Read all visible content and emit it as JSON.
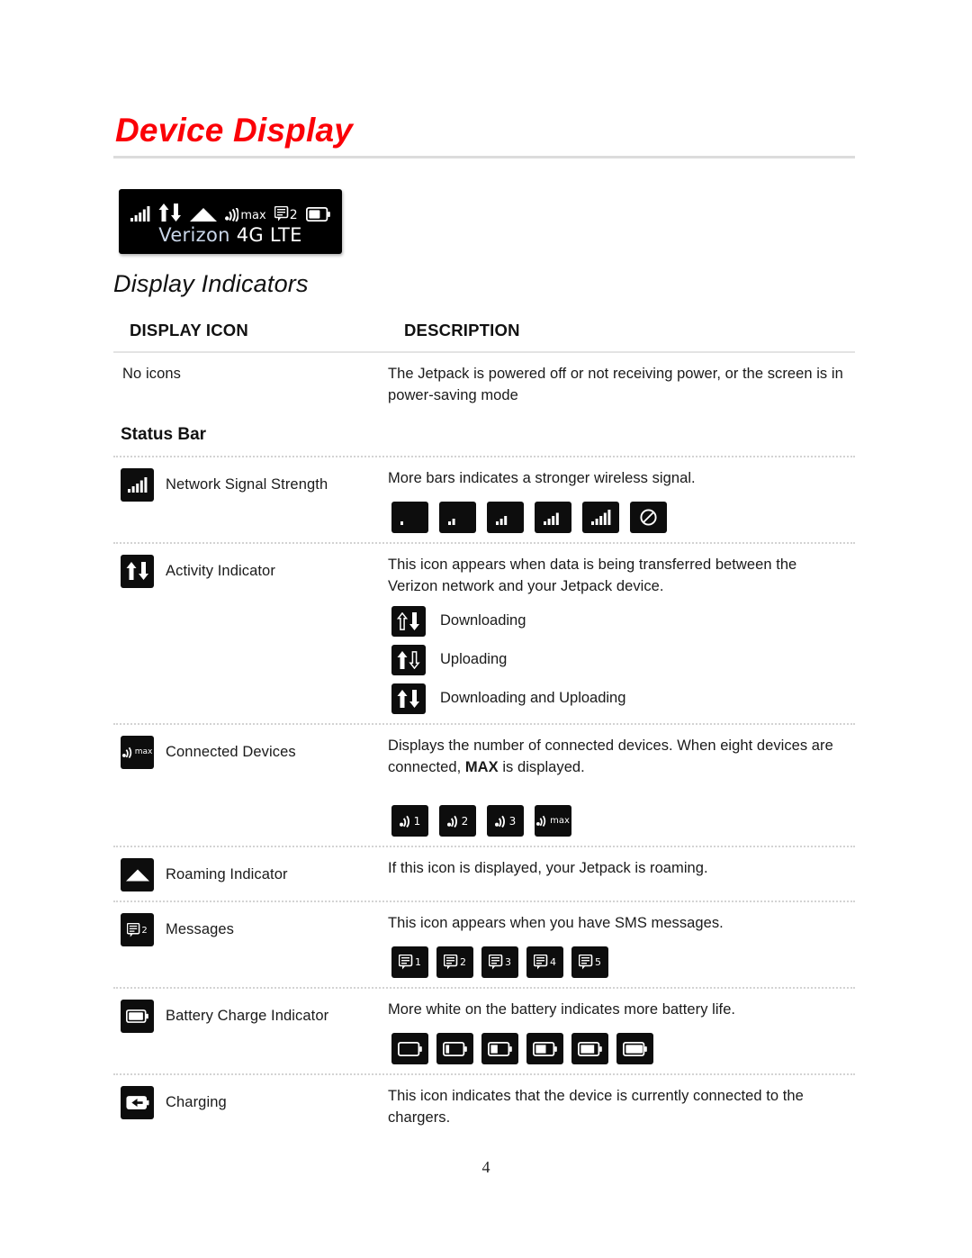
{
  "document": {
    "title": "Device Display",
    "subtitle": "Display Indicators",
    "page_number": "4"
  },
  "device_panel": {
    "name": "jetpack-status-screen",
    "carrier_text_primary": "Verizon ",
    "carrier_text_secondary": "4G LTE",
    "icons": [
      "signal-bars-icon",
      "activity-updown-icon",
      "roaming-triangle-icon",
      "connected-devices-max-icon",
      "messages-2-icon",
      "battery-icon"
    ],
    "connected_label": "max",
    "messages_count": "2"
  },
  "table": {
    "headers": {
      "icon_column": "DISPLAY ICON",
      "description_column": "DESCRIPTION"
    },
    "group_heading": "Status Bar",
    "rows": [
      {
        "id": "no-icons",
        "label": "No icons",
        "description": "The Jetpack is powered off or not receiving power, or the screen is in power-saving mode",
        "has_icon": false,
        "variants": []
      },
      {
        "id": "network-signal-strength",
        "label": "Network Signal Strength",
        "description": "More bars indicates a stronger wireless signal.",
        "has_icon": true,
        "icon": "signal-bars-icon",
        "variants": [
          {
            "name": "signal-0-bars-icon",
            "bars": 0
          },
          {
            "name": "signal-2-bars-icon",
            "bars": 2
          },
          {
            "name": "signal-3-bars-icon",
            "bars": 3
          },
          {
            "name": "signal-4-bars-icon",
            "bars": 4
          },
          {
            "name": "signal-5-bars-icon",
            "bars": 5
          },
          {
            "name": "signal-none-icon",
            "bars": -1
          }
        ]
      },
      {
        "id": "activity-indicator",
        "label": "Activity Indicator",
        "description": "This icon appears when data is being transferred between the Verizon network and your Jetpack device.",
        "has_icon": true,
        "icon": "activity-updown-icon",
        "activity_modes": [
          {
            "name": "downloading-icon",
            "label": "Downloading",
            "up": "outline",
            "down": "filled"
          },
          {
            "name": "uploading-icon",
            "label": "Uploading",
            "up": "filled",
            "down": "outline"
          },
          {
            "name": "downloading-uploading-icon",
            "label": "Downloading and Uploading",
            "up": "filled",
            "down": "filled"
          }
        ]
      },
      {
        "id": "connected-devices",
        "label": "Connected Devices",
        "description_part1": "Displays the number of connected devices. When eight devices are connected, ",
        "description_bold": "MAX",
        "description_part2": " is displayed.",
        "has_icon": true,
        "icon": "connected-devices-max-icon",
        "variants": [
          {
            "name": "connected-devices-1-icon",
            "text": "1"
          },
          {
            "name": "connected-devices-2-icon",
            "text": "2"
          },
          {
            "name": "connected-devices-3-icon",
            "text": "3"
          },
          {
            "name": "connected-devices-max-icon",
            "text": "max"
          }
        ]
      },
      {
        "id": "roaming-indicator",
        "label": "Roaming Indicator",
        "description": "If this icon is displayed, your Jetpack is roaming.",
        "has_icon": true,
        "icon": "roaming-triangle-icon",
        "variants": []
      },
      {
        "id": "messages",
        "label": "Messages",
        "description": "This icon appears when you have SMS messages.",
        "has_icon": true,
        "icon": "messages-2-icon",
        "variants": [
          {
            "name": "messages-1-icon",
            "text": "1"
          },
          {
            "name": "messages-2-icon",
            "text": "2"
          },
          {
            "name": "messages-3-icon",
            "text": "3"
          },
          {
            "name": "messages-4-icon",
            "text": "4"
          },
          {
            "name": "messages-5-icon",
            "text": "5"
          }
        ]
      },
      {
        "id": "battery-charge-indicator",
        "label": "Battery Charge Indicator",
        "description": "More white on the battery indicates more battery life.",
        "has_icon": true,
        "icon": "battery-icon",
        "variants": [
          {
            "name": "battery-0-icon",
            "fill": 0
          },
          {
            "name": "battery-20-icon",
            "fill": 20
          },
          {
            "name": "battery-40-icon",
            "fill": 40
          },
          {
            "name": "battery-60-icon",
            "fill": 60
          },
          {
            "name": "battery-80-icon",
            "fill": 80
          },
          {
            "name": "battery-100-icon",
            "fill": 100
          }
        ]
      },
      {
        "id": "charging",
        "label": "Charging",
        "description": "This icon indicates that the device is currently connected to the chargers.",
        "has_icon": true,
        "icon": "battery-charging-icon",
        "variants": []
      }
    ]
  },
  "colors": {
    "title_red": "#fb0007",
    "icon_tile_black": "#0d0d0d",
    "rule_gray": "#e3e3e3"
  }
}
